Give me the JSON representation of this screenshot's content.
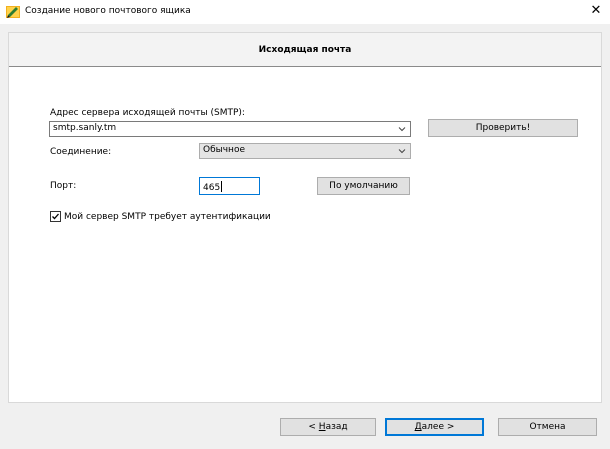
{
  "window": {
    "title": "Создание нового почтового ящика",
    "close_glyph": "✕"
  },
  "panel": {
    "title": "Исходящая почта"
  },
  "form": {
    "smtp_label": "Адрес сервера исходящей почты (SMTP):",
    "smtp_value": "smtp.sanly.tm",
    "check_button": "Проверить!",
    "connection_label": "Соединение:",
    "connection_value": "Обычное",
    "port_label": "Порт:",
    "port_value": "465",
    "default_button": "По умолчанию",
    "auth_checkbox_label": "Мой сервер SMTP требует аутентификации",
    "auth_checked": true
  },
  "footer": {
    "back_prefix": "< ",
    "back_mnemonic": "Н",
    "back_rest": "азад",
    "next_mnemonic": "Д",
    "next_rest": "алее",
    "next_suffix": " >",
    "cancel": "Отмена"
  }
}
